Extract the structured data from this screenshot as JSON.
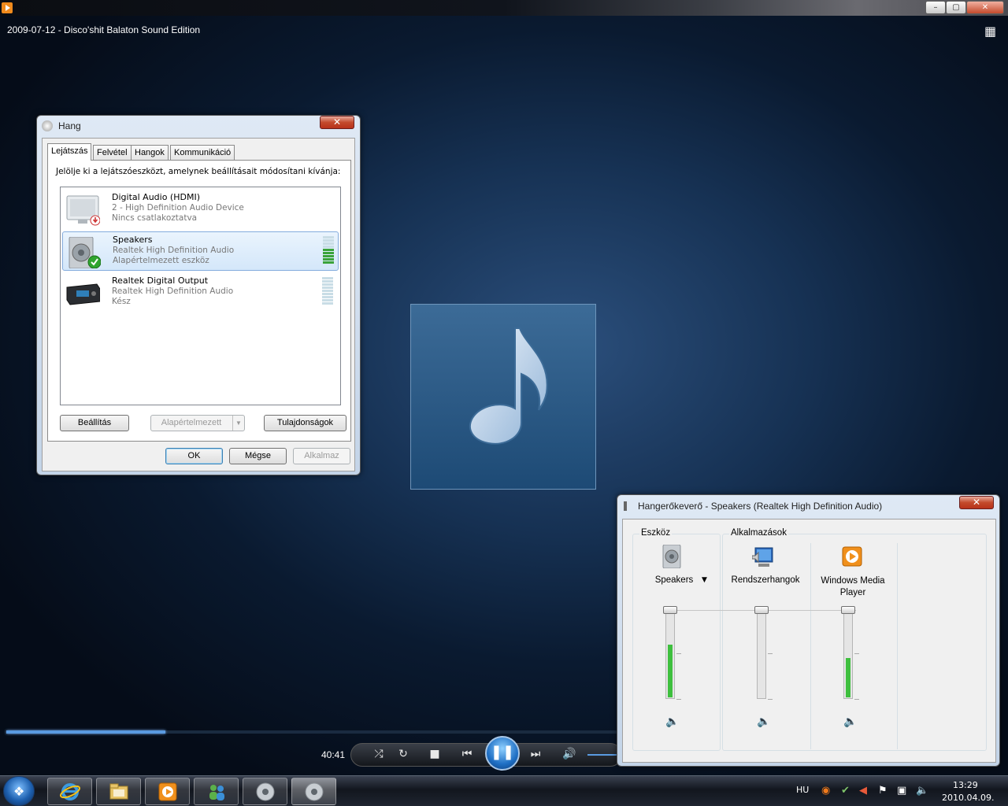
{
  "wmp": {
    "now_playing": "2009-07-12 - Disco'shit Balaton Sound Edition",
    "elapsed": "40:41",
    "seek_progress": 0.26,
    "caption": {
      "minimize": "–",
      "maximize": "▢",
      "close": "✕"
    }
  },
  "sound_dialog": {
    "title": "Hang",
    "close": "✕",
    "tabs": [
      "Lejátszás",
      "Felvétel",
      "Hangok",
      "Kommunikáció"
    ],
    "active_tab": 0,
    "instruction": "Jelölje ki a lejátszóeszközt, amelynek beállításait módosítani kívánja:",
    "devices": [
      {
        "name": "Digital Audio (HDMI)",
        "line2": "2 - High Definition Audio Device",
        "line3": "Nincs csatlakoztatva",
        "icon": "monitor-icon",
        "status": "disconnected"
      },
      {
        "name": "Speakers",
        "line2": "Realtek High Definition Audio",
        "line3": "Alapértelmezett eszköz",
        "icon": "speaker-icon",
        "status": "default",
        "meter_level": 0.5
      },
      {
        "name": "Realtek Digital Output",
        "line2": "Realtek High Definition Audio",
        "line3": "Kész",
        "icon": "receiver-icon",
        "status": "ready",
        "meter_level": 0
      }
    ],
    "buttons": {
      "configure": "Beállítás",
      "set_default": "Alapértelmezett",
      "properties": "Tulajdonságok",
      "ok": "OK",
      "cancel": "Mégse",
      "apply": "Alkalmaz"
    }
  },
  "mixer": {
    "title": "Hangerőkeverő - Speakers (Realtek High Definition Audio)",
    "close": "✕",
    "device_group": "Eszköz",
    "apps_group": "Alkalmazások",
    "channels": [
      {
        "label": "Speakers",
        "level": 0.6,
        "icon": "speaker-icon",
        "has_dropdown": true
      },
      {
        "label": "Rendszerhangok",
        "level": 0,
        "icon": "system-sounds-icon"
      },
      {
        "label": "Windows Media Player",
        "level": 0.45,
        "icon": "wmp-icon"
      }
    ]
  },
  "taskbar": {
    "language": "HU",
    "time": "13:29",
    "date": "2010.04.09.",
    "apps": [
      "internet-explorer-icon",
      "explorer-icon",
      "windows-media-player-icon",
      "messenger-icon",
      "sound-icon",
      "sound-icon"
    ],
    "active_app": 5
  },
  "colors": {
    "accent": "#3ebf3e",
    "selection": "#d4e7fa",
    "close_red": "#c34a2c"
  }
}
